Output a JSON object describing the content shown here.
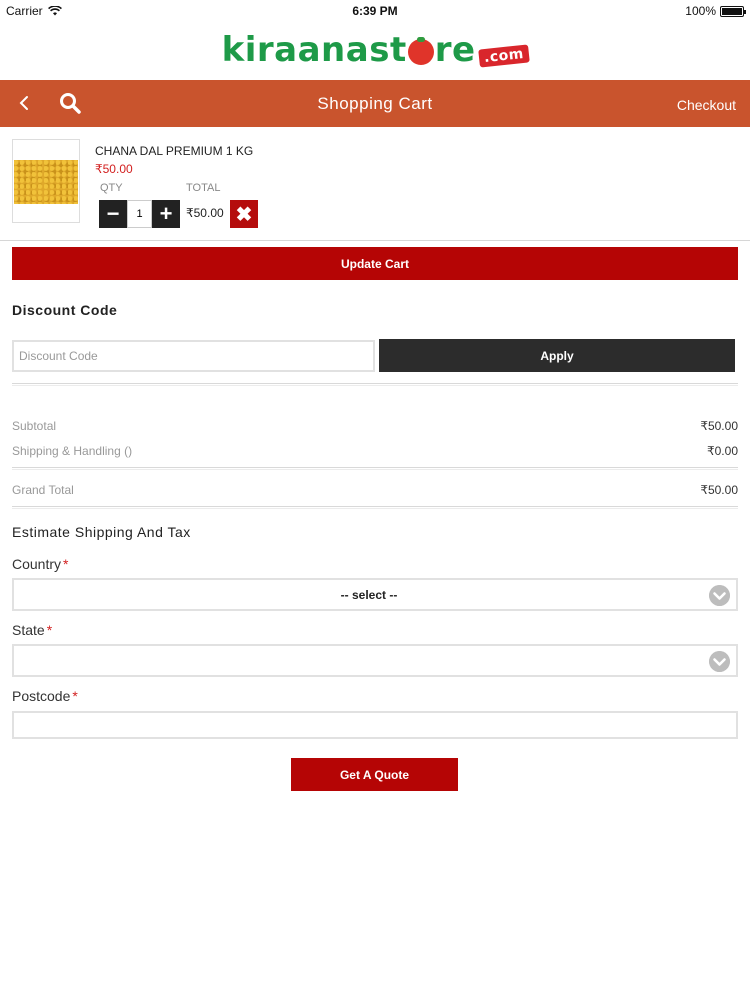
{
  "status_bar": {
    "carrier": "Carrier",
    "time": "6:39 PM",
    "battery": "100%"
  },
  "logo": {
    "part1": "kiraanast",
    "part2": "re",
    "dotcom": ".com"
  },
  "header": {
    "title": "Shopping Cart",
    "checkout_label": "Checkout",
    "accent_color": "#c9542d"
  },
  "cart_item": {
    "name": "CHANA DAL PREMIUM 1 KG",
    "price": "₹50.00",
    "qty_label": "QTY",
    "total_label": "TOTAL",
    "quantity": "1",
    "total": "₹50.00",
    "remove_icon": "✖",
    "minus_icon": "−",
    "plus_icon": "+"
  },
  "update_cart_label": "Update Cart",
  "discount": {
    "title": "Discount Code",
    "placeholder": "Discount Code",
    "apply_label": "Apply"
  },
  "summary": {
    "subtotal_label": "Subtotal",
    "subtotal_value": "₹50.00",
    "shipping_label": "Shipping & Handling ()",
    "shipping_value": "₹0.00",
    "grand_total_label": "Grand Total",
    "grand_total_value": "₹50.00"
  },
  "estimate": {
    "title": "Estimate Shipping And Tax",
    "country_label": "Country",
    "country_value": "-- select --",
    "state_label": "State",
    "state_value": "",
    "postcode_label": "Postcode",
    "required_mark": "*",
    "quote_label": "Get A Quote"
  },
  "colors": {
    "button_red": "#b50505",
    "price_red": "#d21f1f",
    "dark_button": "#2c2c2c"
  }
}
